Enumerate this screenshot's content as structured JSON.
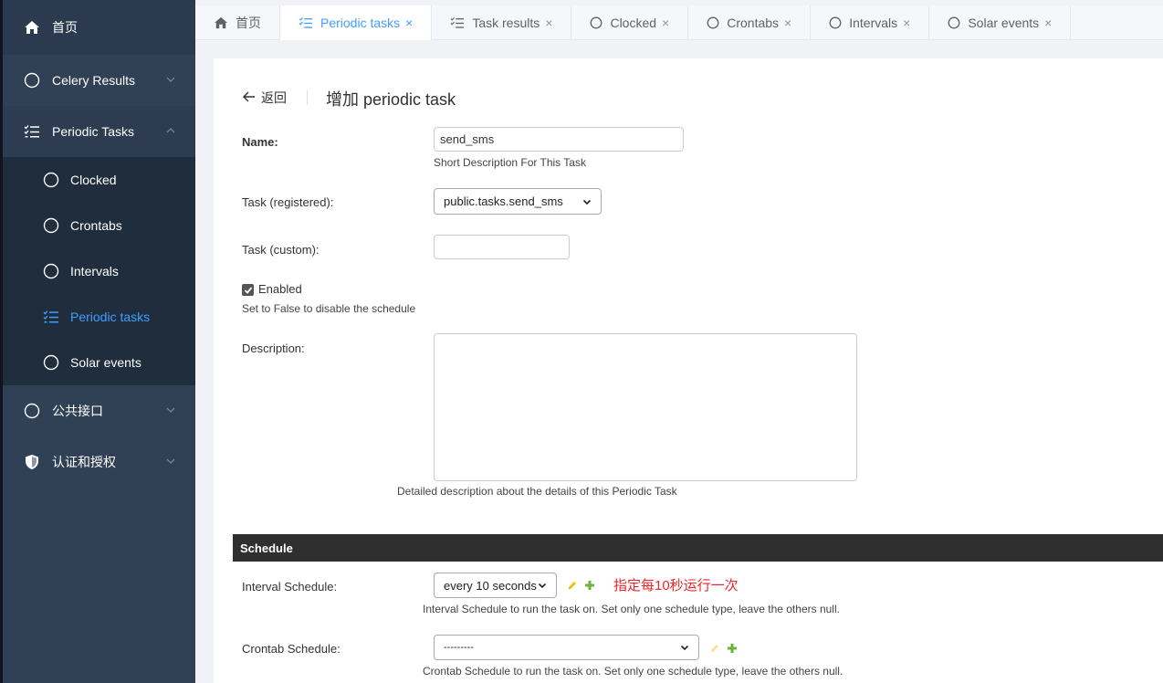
{
  "sidebar": {
    "home": "首页",
    "celery_results": "Celery Results",
    "periodic_tasks_group": "Periodic Tasks",
    "sub_items": [
      "Clocked",
      "Crontabs",
      "Intervals",
      "Periodic tasks",
      "Solar events"
    ],
    "public_api": "公共接口",
    "auth": "认证和授权"
  },
  "tabs": [
    "首页",
    "Periodic tasks",
    "Task results",
    "Clocked",
    "Crontabs",
    "Intervals",
    "Solar events"
  ],
  "page": {
    "back_label": "返回",
    "title": "增加 periodic task"
  },
  "form": {
    "name_label": "Name:",
    "name_value": "send_sms",
    "name_help": "Short Description For This Task",
    "task_registered_label": "Task (registered):",
    "task_registered_value": "public.tasks.send_sms",
    "task_custom_label": "Task (custom):",
    "task_custom_value": "",
    "enabled_label": "Enabled",
    "enabled_checked": true,
    "enabled_help": "Set to False to disable the schedule",
    "description_label": "Description:",
    "description_value": "",
    "description_help": "Detailed description about the details of this Periodic Task"
  },
  "schedule": {
    "heading": "Schedule",
    "interval_label": "Interval Schedule:",
    "interval_value": "every 10 seconds",
    "interval_help": "Interval Schedule to run the task on. Set only one schedule type, leave the others null.",
    "annotation": "指定每10秒运行一次",
    "crontab_label": "Crontab Schedule:",
    "crontab_value": "---------",
    "crontab_help": "Crontab Schedule to run the task on. Set only one schedule type, leave the others null."
  },
  "colors": {
    "sidebar_bg": "#304156",
    "submenu_bg": "#1f2d3d",
    "accent": "#409eff",
    "annotation": "#e8262d",
    "pencil": "#f0c000",
    "plus": "#6cb33e"
  }
}
